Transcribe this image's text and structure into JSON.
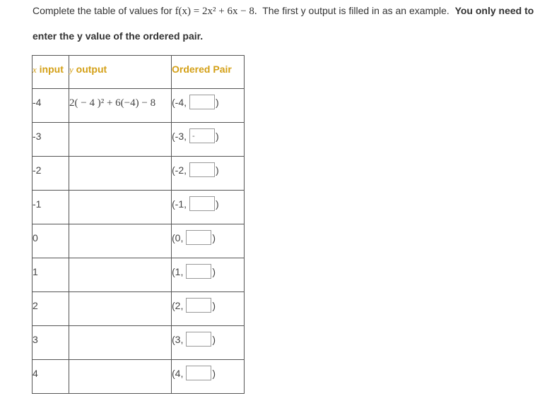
{
  "instructions": {
    "prefix": "Complete the table of values for ",
    "function_expression": "f(x) = 2x² + 6x − 8.",
    "middle": "  The first y output is filled in as an example.  ",
    "bold_part1": "You only need to",
    "bold_part2": "enter the y value of the ordered pair."
  },
  "table": {
    "headers": {
      "x_var": "x",
      "x_label": " input",
      "y_var": "y",
      "y_label": " output",
      "pair_label": "Ordered Pair"
    },
    "header_color": "#d4a017",
    "rows": [
      {
        "x": "-4",
        "y_output": "2( − 4 )² + 6(−4) − 8",
        "pair_prefix": "(-4,",
        "answer": "",
        "pair_suffix": ")"
      },
      {
        "x": "-3",
        "y_output": "",
        "pair_prefix": "(-3,",
        "answer": "-",
        "pair_suffix": ")"
      },
      {
        "x": "-2",
        "y_output": "",
        "pair_prefix": "(-2,",
        "answer": "",
        "pair_suffix": ")"
      },
      {
        "x": "-1",
        "y_output": "",
        "pair_prefix": "(-1,",
        "answer": "",
        "pair_suffix": ")"
      },
      {
        "x": "0",
        "y_output": "",
        "pair_prefix": "(0,",
        "answer": "",
        "pair_suffix": ")"
      },
      {
        "x": "1",
        "y_output": "",
        "pair_prefix": "(1,",
        "answer": "",
        "pair_suffix": ")"
      },
      {
        "x": "2",
        "y_output": "",
        "pair_prefix": "(2,",
        "answer": "",
        "pair_suffix": ")"
      },
      {
        "x": "3",
        "y_output": "",
        "pair_prefix": "(3,",
        "answer": "",
        "pair_suffix": ")"
      },
      {
        "x": "4",
        "y_output": "",
        "pair_prefix": "(4,",
        "answer": "",
        "pair_suffix": ")"
      }
    ]
  }
}
